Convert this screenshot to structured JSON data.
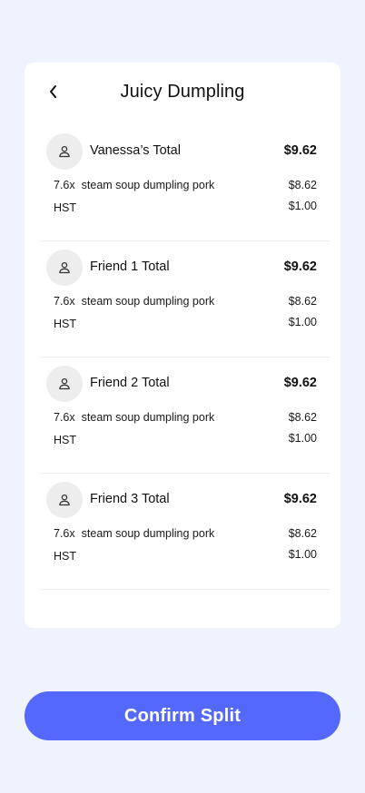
{
  "header": {
    "title": "Juicy Dumpling",
    "back_icon": "chevron-left-icon"
  },
  "people": [
    {
      "name": "Vanessa’s Total",
      "total": "$9.62",
      "avatar_icon": "user-icon",
      "item": {
        "qty": "7.6x",
        "description": "steam soup dumpling pork",
        "amount": "$8.62"
      },
      "tax": {
        "label": "HST",
        "amount": "$1.00"
      }
    },
    {
      "name": "Friend 1 Total",
      "total": "$9.62",
      "avatar_icon": "user-icon",
      "item": {
        "qty": "7.6x",
        "description": "steam soup dumpling pork",
        "amount": "$8.62"
      },
      "tax": {
        "label": "HST",
        "amount": "$1.00"
      }
    },
    {
      "name": "Friend 2 Total",
      "total": "$9.62",
      "avatar_icon": "user-icon",
      "item": {
        "qty": "7.6x",
        "description": "steam soup dumpling pork",
        "amount": "$8.62"
      },
      "tax": {
        "label": "HST",
        "amount": "$1.00"
      }
    },
    {
      "name": "Friend 3 Total",
      "total": "$9.62",
      "avatar_icon": "user-icon",
      "item": {
        "qty": "7.6x",
        "description": "steam soup dumpling pork",
        "amount": "$8.62"
      },
      "tax": {
        "label": "HST",
        "amount": "$1.00"
      }
    }
  ],
  "confirm_label": "Confirm Split",
  "colors": {
    "background": "#eff3fe",
    "card": "#ffffff",
    "accent": "#5468fb",
    "avatar_bg": "#ededed",
    "divider": "#eceef2"
  }
}
